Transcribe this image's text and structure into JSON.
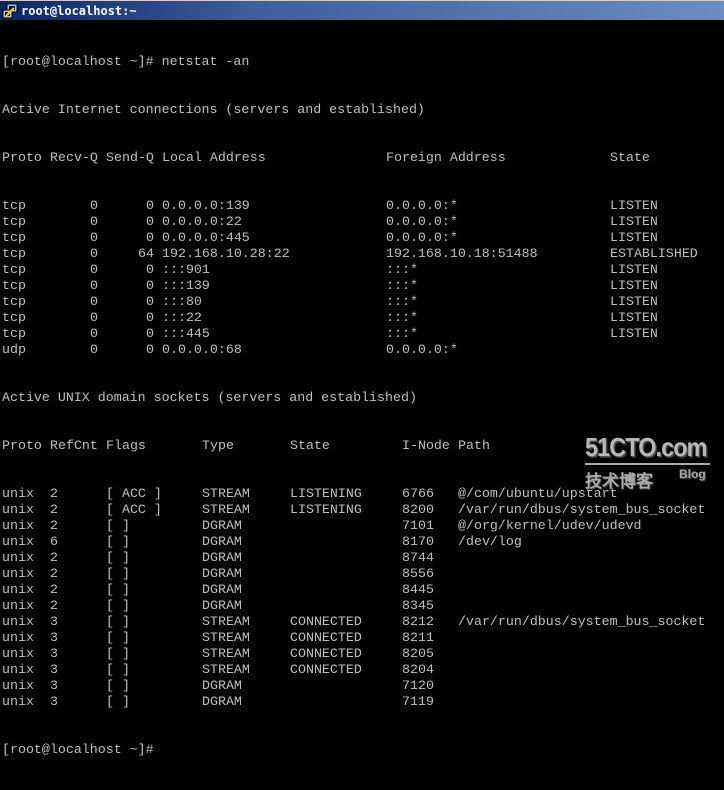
{
  "window": {
    "title": "root@localhost:~",
    "title_icon": "putty-icon",
    "colors": {
      "title_start": "#0a246a",
      "title_end": "#6a8dc6",
      "terminal_bg": "#000000",
      "terminal_fg": "#c0c0c0"
    }
  },
  "terminal": {
    "prompt_command": "[root@localhost ~]# netstat -an",
    "inet_header": "Active Internet connections (servers and established)",
    "inet_columns": [
      "Proto",
      "Recv-Q",
      "Send-Q",
      "Local Address",
      "Foreign Address",
      "State"
    ],
    "inet_rows": [
      {
        "proto": "tcp",
        "recvq": "0",
        "sendq": "0",
        "local": "0.0.0.0:139",
        "foreign": "0.0.0.0:*",
        "state": "LISTEN"
      },
      {
        "proto": "tcp",
        "recvq": "0",
        "sendq": "0",
        "local": "0.0.0.0:22",
        "foreign": "0.0.0.0:*",
        "state": "LISTEN"
      },
      {
        "proto": "tcp",
        "recvq": "0",
        "sendq": "0",
        "local": "0.0.0.0:445",
        "foreign": "0.0.0.0:*",
        "state": "LISTEN"
      },
      {
        "proto": "tcp",
        "recvq": "0",
        "sendq": "64",
        "local": "192.168.10.28:22",
        "foreign": "192.168.10.18:51488",
        "state": "ESTABLISHED"
      },
      {
        "proto": "tcp",
        "recvq": "0",
        "sendq": "0",
        "local": ":::901",
        "foreign": ":::*",
        "state": "LISTEN"
      },
      {
        "proto": "tcp",
        "recvq": "0",
        "sendq": "0",
        "local": ":::139",
        "foreign": ":::*",
        "state": "LISTEN"
      },
      {
        "proto": "tcp",
        "recvq": "0",
        "sendq": "0",
        "local": ":::80",
        "foreign": ":::*",
        "state": "LISTEN"
      },
      {
        "proto": "tcp",
        "recvq": "0",
        "sendq": "0",
        "local": ":::22",
        "foreign": ":::*",
        "state": "LISTEN"
      },
      {
        "proto": "tcp",
        "recvq": "0",
        "sendq": "0",
        "local": ":::445",
        "foreign": ":::*",
        "state": "LISTEN"
      },
      {
        "proto": "udp",
        "recvq": "0",
        "sendq": "0",
        "local": "0.0.0.0:68",
        "foreign": "0.0.0.0:*",
        "state": ""
      }
    ],
    "unix_header": "Active UNIX domain sockets (servers and established)",
    "unix_columns": [
      "Proto",
      "RefCnt",
      "Flags",
      "Type",
      "State",
      "I-Node",
      "Path"
    ],
    "unix_rows": [
      {
        "proto": "unix",
        "refcnt": "2",
        "flags": "[ ACC ]",
        "type": "STREAM",
        "state": "LISTENING",
        "inode": "6766",
        "path": "@/com/ubuntu/upstart"
      },
      {
        "proto": "unix",
        "refcnt": "2",
        "flags": "[ ACC ]",
        "type": "STREAM",
        "state": "LISTENING",
        "inode": "8200",
        "path": "/var/run/dbus/system_bus_socket"
      },
      {
        "proto": "unix",
        "refcnt": "2",
        "flags": "[ ]",
        "type": "DGRAM",
        "state": "",
        "inode": "7101",
        "path": "@/org/kernel/udev/udevd"
      },
      {
        "proto": "unix",
        "refcnt": "6",
        "flags": "[ ]",
        "type": "DGRAM",
        "state": "",
        "inode": "8170",
        "path": "/dev/log"
      },
      {
        "proto": "unix",
        "refcnt": "2",
        "flags": "[ ]",
        "type": "DGRAM",
        "state": "",
        "inode": "8744",
        "path": ""
      },
      {
        "proto": "unix",
        "refcnt": "2",
        "flags": "[ ]",
        "type": "DGRAM",
        "state": "",
        "inode": "8556",
        "path": ""
      },
      {
        "proto": "unix",
        "refcnt": "2",
        "flags": "[ ]",
        "type": "DGRAM",
        "state": "",
        "inode": "8445",
        "path": ""
      },
      {
        "proto": "unix",
        "refcnt": "2",
        "flags": "[ ]",
        "type": "DGRAM",
        "state": "",
        "inode": "8345",
        "path": ""
      },
      {
        "proto": "unix",
        "refcnt": "3",
        "flags": "[ ]",
        "type": "STREAM",
        "state": "CONNECTED",
        "inode": "8212",
        "path": "/var/run/dbus/system_bus_socket"
      },
      {
        "proto": "unix",
        "refcnt": "3",
        "flags": "[ ]",
        "type": "STREAM",
        "state": "CONNECTED",
        "inode": "8211",
        "path": ""
      },
      {
        "proto": "unix",
        "refcnt": "3",
        "flags": "[ ]",
        "type": "STREAM",
        "state": "CONNECTED",
        "inode": "8205",
        "path": ""
      },
      {
        "proto": "unix",
        "refcnt": "3",
        "flags": "[ ]",
        "type": "STREAM",
        "state": "CONNECTED",
        "inode": "8204",
        "path": ""
      },
      {
        "proto": "unix",
        "refcnt": "3",
        "flags": "[ ]",
        "type": "DGRAM",
        "state": "",
        "inode": "7120",
        "path": ""
      },
      {
        "proto": "unix",
        "refcnt": "3",
        "flags": "[ ]",
        "type": "DGRAM",
        "state": "",
        "inode": "7119",
        "path": ""
      }
    ],
    "final_prompt": "[root@localhost ~]#"
  },
  "watermark": {
    "brand": "51CTO.com",
    "subtitle_cn": "技术博客",
    "subtitle_en": "Blog"
  }
}
